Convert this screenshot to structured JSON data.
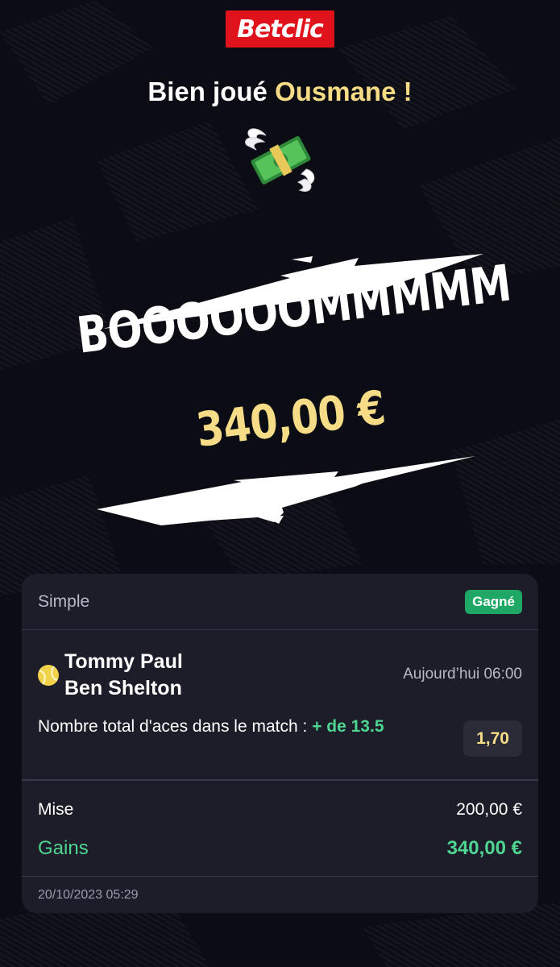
{
  "brand": {
    "logo_text": "Betclic",
    "color": "#e0121b"
  },
  "header": {
    "greeting_prefix": "Bien joué",
    "user_name": "Ousmane",
    "greeting_suffix": "!"
  },
  "celebration": {
    "emoji": "money-with-wings",
    "headline": "BOOOOOOMMMMM",
    "amount": "340,00 €"
  },
  "bet": {
    "type": "Simple",
    "status": "Gagné",
    "event": {
      "sport_icon": "tennis-ball-icon",
      "player1": "Tommy Paul",
      "player2": "Ben Shelton",
      "time": "Aujourd’hui 06:00",
      "market": "Nombre total d'aces dans le match :",
      "pick": "+ de 13.5",
      "odds": "1,70"
    },
    "stake_label": "Mise",
    "stake_value": "200,00 €",
    "winnings_label": "Gains",
    "winnings_value": "340,00 €",
    "placed_at": "20/10/2023 05:29"
  },
  "colors": {
    "accent_gold": "#f6dc86",
    "win_green": "#4ed591",
    "badge_green": "#1fa765",
    "card_bg": "#1c1d28"
  }
}
